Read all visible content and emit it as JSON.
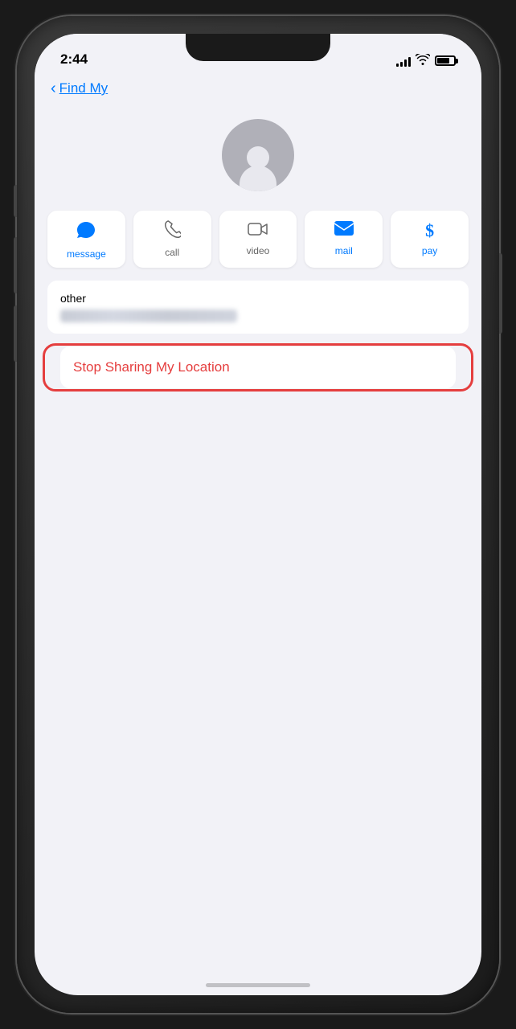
{
  "status_bar": {
    "time": "2:44",
    "signal_bars": [
      4,
      6,
      8,
      10,
      12
    ],
    "battery_level": "75%"
  },
  "navigation": {
    "back_label": "Find My",
    "back_chevron": "‹"
  },
  "contact": {
    "label": "other"
  },
  "action_buttons": [
    {
      "id": "message",
      "label": "message",
      "label_class": "blue",
      "icon": "💬"
    },
    {
      "id": "call",
      "label": "call",
      "label_class": "",
      "icon": "📞"
    },
    {
      "id": "video",
      "label": "video",
      "label_class": "",
      "icon": "📹"
    },
    {
      "id": "mail",
      "label": "mail",
      "label_class": "blue",
      "icon": "✉️"
    },
    {
      "id": "pay",
      "label": "pay",
      "label_class": "blue",
      "icon": "$"
    }
  ],
  "stop_sharing": {
    "label": "Stop Sharing My Location"
  },
  "colors": {
    "blue": "#007aff",
    "red": "#e53e3e",
    "background": "#f2f2f7"
  }
}
